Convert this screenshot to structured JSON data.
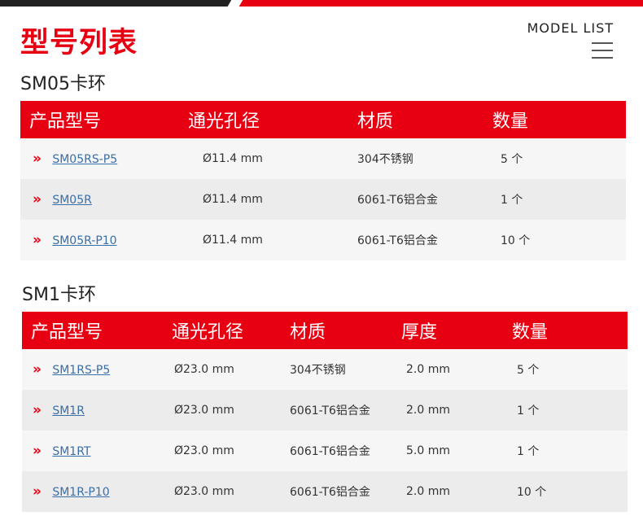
{
  "page": {
    "title": "型号列表",
    "model_list": "MODEL LIST",
    "menu_icon": "hamburger-menu-icon",
    "accent_color": "#e60012",
    "link_color": "#3a6ea8"
  },
  "sections": [
    {
      "title": "SM05卡环",
      "headers": [
        "产品型号",
        "通光孔径",
        "材质",
        "数量"
      ],
      "rows": [
        {
          "model": "SM05RS-P5",
          "aperture": "Ø11.4 mm",
          "material": "304不锈钢",
          "qty": "5 个"
        },
        {
          "model": "SM05R",
          "aperture": "Ø11.4 mm",
          "material": "6061-T6铝合金",
          "qty": "1 个"
        },
        {
          "model": "SM05R-P10",
          "aperture": "Ø11.4 mm",
          "material": "6061-T6铝合金",
          "qty": "10 个"
        }
      ]
    },
    {
      "title": "SM1卡环",
      "headers": [
        "产品型号",
        "通光孔径",
        "材质",
        "厚度",
        "数量"
      ],
      "rows": [
        {
          "model": "SM1RS-P5",
          "aperture": "Ø23.0 mm",
          "material": "304不锈钢",
          "thickness": "2.0 mm",
          "qty": "5 个"
        },
        {
          "model": "SM1R",
          "aperture": "Ø23.0 mm",
          "material": "6061-T6铝合金",
          "thickness": "2.0 mm",
          "qty": "1 个"
        },
        {
          "model": "SM1RT",
          "aperture": "Ø23.0 mm",
          "material": "6061-T6铝合金",
          "thickness": "5.0 mm",
          "qty": "1 个"
        },
        {
          "model": "SM1R-P10",
          "aperture": "Ø23.0 mm",
          "material": "6061-T6铝合金",
          "thickness": "2.0 mm",
          "qty": "10 个"
        }
      ]
    }
  ],
  "row_arrow": "»"
}
